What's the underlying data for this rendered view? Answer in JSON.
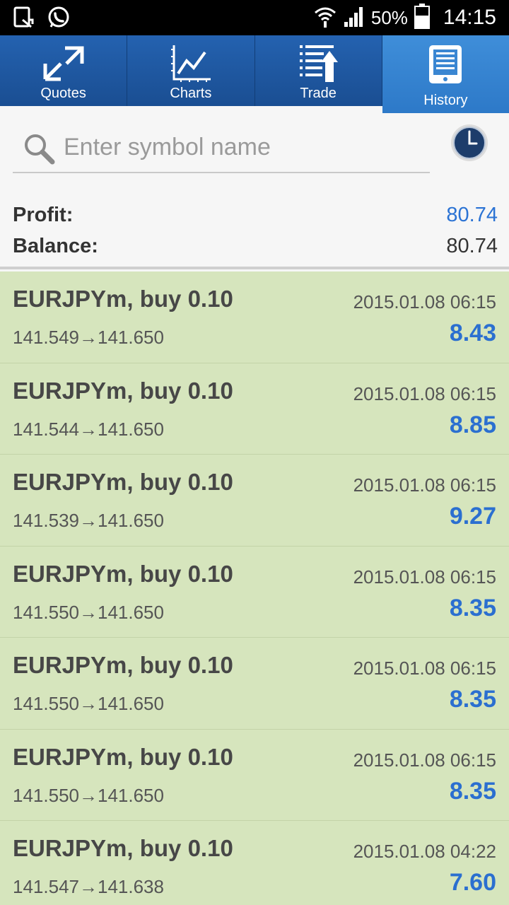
{
  "status_bar": {
    "battery_percent": "50%",
    "time": "14:15",
    "icons": [
      "notification-icon",
      "whatsapp-icon",
      "wifi-icon",
      "signal-icon",
      "battery-icon"
    ]
  },
  "tabs": [
    {
      "label": "Quotes",
      "icon": "quotes-arrows-icon",
      "active": false
    },
    {
      "label": "Charts",
      "icon": "chart-line-icon",
      "active": false
    },
    {
      "label": "Trade",
      "icon": "trade-list-icon",
      "active": false
    },
    {
      "label": "History",
      "icon": "history-tablet-icon",
      "active": true
    }
  ],
  "search": {
    "placeholder": "Enter symbol name",
    "value": ""
  },
  "summary": {
    "profit_label": "Profit:",
    "profit_value": "80.74",
    "balance_label": "Balance:",
    "balance_value": "80.74"
  },
  "colors": {
    "tab_bar": "#1b4f91",
    "tab_active": "#3384d0",
    "row_background": "#d6e5bd",
    "profit_blue": "#2b6fd0"
  },
  "history": [
    {
      "title": "EURJPYm, buy 0.10",
      "date": "2015.01.08 06:15",
      "prices": "141.549→141.650",
      "profit": "8.43"
    },
    {
      "title": "EURJPYm, buy 0.10",
      "date": "2015.01.08 06:15",
      "prices": "141.544→141.650",
      "profit": "8.85"
    },
    {
      "title": "EURJPYm, buy 0.10",
      "date": "2015.01.08 06:15",
      "prices": "141.539→141.650",
      "profit": "9.27"
    },
    {
      "title": "EURJPYm, buy 0.10",
      "date": "2015.01.08 06:15",
      "prices": "141.550→141.650",
      "profit": "8.35"
    },
    {
      "title": "EURJPYm, buy 0.10",
      "date": "2015.01.08 06:15",
      "prices": "141.550→141.650",
      "profit": "8.35"
    },
    {
      "title": "EURJPYm, buy 0.10",
      "date": "2015.01.08 06:15",
      "prices": "141.550→141.650",
      "profit": "8.35"
    },
    {
      "title": "EURJPYm, buy 0.10",
      "date": "2015.01.08 04:22",
      "prices": "141.547→141.638",
      "profit": "7.60"
    }
  ]
}
